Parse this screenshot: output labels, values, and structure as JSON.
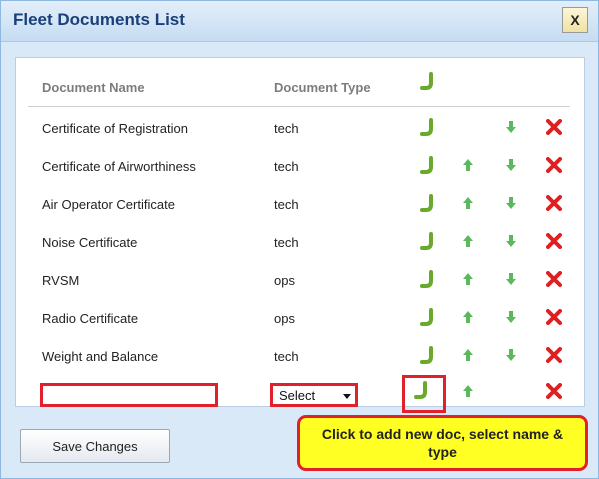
{
  "dialog": {
    "title": "Fleet Documents List",
    "close_label": "X"
  },
  "table": {
    "columns": [
      "Document Name",
      "Document Type"
    ],
    "rows": [
      {
        "name": "Certificate of Registration",
        "type": "tech",
        "up": false,
        "down": true
      },
      {
        "name": "Certificate of Airworthiness",
        "type": "tech",
        "up": true,
        "down": true
      },
      {
        "name": "Air Operator Certificate",
        "type": "tech",
        "up": true,
        "down": true
      },
      {
        "name": "Noise Certificate",
        "type": "tech",
        "up": true,
        "down": true
      },
      {
        "name": "RVSM",
        "type": "ops",
        "up": true,
        "down": true
      },
      {
        "name": "Radio Certificate",
        "type": "ops",
        "up": true,
        "down": true
      },
      {
        "name": "Weight and Balance",
        "type": "tech",
        "up": true,
        "down": true
      }
    ]
  },
  "new_row": {
    "name_value": "",
    "type_value": "Select"
  },
  "save_label": "Save Changes",
  "hint_text": "Click to add new doc, select name & type",
  "colors": {
    "title": "#1a3f7a",
    "edit_icon": "#6aaa2a",
    "arrow_icon": "#5cb85c",
    "delete_icon": "#e02020",
    "highlight_border": "#e0202a",
    "hint_bg": "#ffff24"
  },
  "icons": {
    "edit": "return-arrow-icon",
    "up": "arrow-up-icon",
    "down": "arrow-down-icon",
    "delete": "delete-x-icon"
  }
}
